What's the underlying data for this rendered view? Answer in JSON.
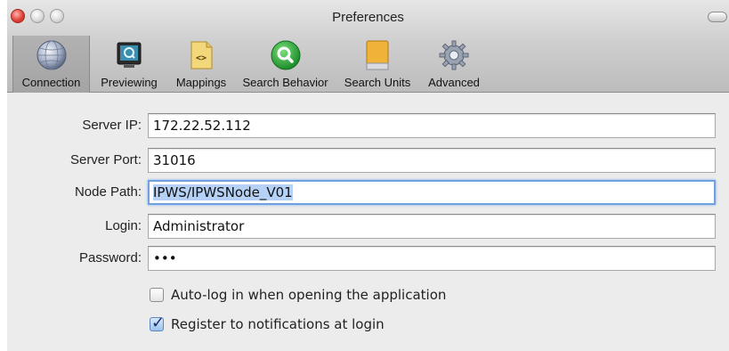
{
  "window": {
    "title": "Preferences"
  },
  "toolbar": {
    "items": [
      {
        "label": "Connection",
        "icon": "globe-icon",
        "selected": true
      },
      {
        "label": "Previewing",
        "icon": "monitor-icon",
        "selected": false
      },
      {
        "label": "Mappings",
        "icon": "xml-file-icon",
        "selected": false
      },
      {
        "label": "Search Behavior",
        "icon": "magnifier-icon",
        "selected": false
      },
      {
        "label": "Search Units",
        "icon": "drive-icon",
        "selected": false
      },
      {
        "label": "Advanced",
        "icon": "gear-icon",
        "selected": false
      }
    ]
  },
  "form": {
    "server_ip": {
      "label": "Server IP:",
      "value": "172.22.52.112"
    },
    "server_port": {
      "label": "Server Port:",
      "value": "31016"
    },
    "node_path": {
      "label": "Node Path:",
      "value": "IPWS/IPWSNode_V01"
    },
    "login": {
      "label": "Login:",
      "value": "Administrator"
    },
    "password": {
      "label": "Password:",
      "value": "•••"
    },
    "auto_login": {
      "label": "Auto-log in when opening the application",
      "checked": false
    },
    "register": {
      "label": "Register to notifications at login",
      "checked": true
    }
  },
  "colors": {
    "focus_ring": "#6fa0e0",
    "selection": "#b5d2f6",
    "close_button": "#e0443a"
  }
}
